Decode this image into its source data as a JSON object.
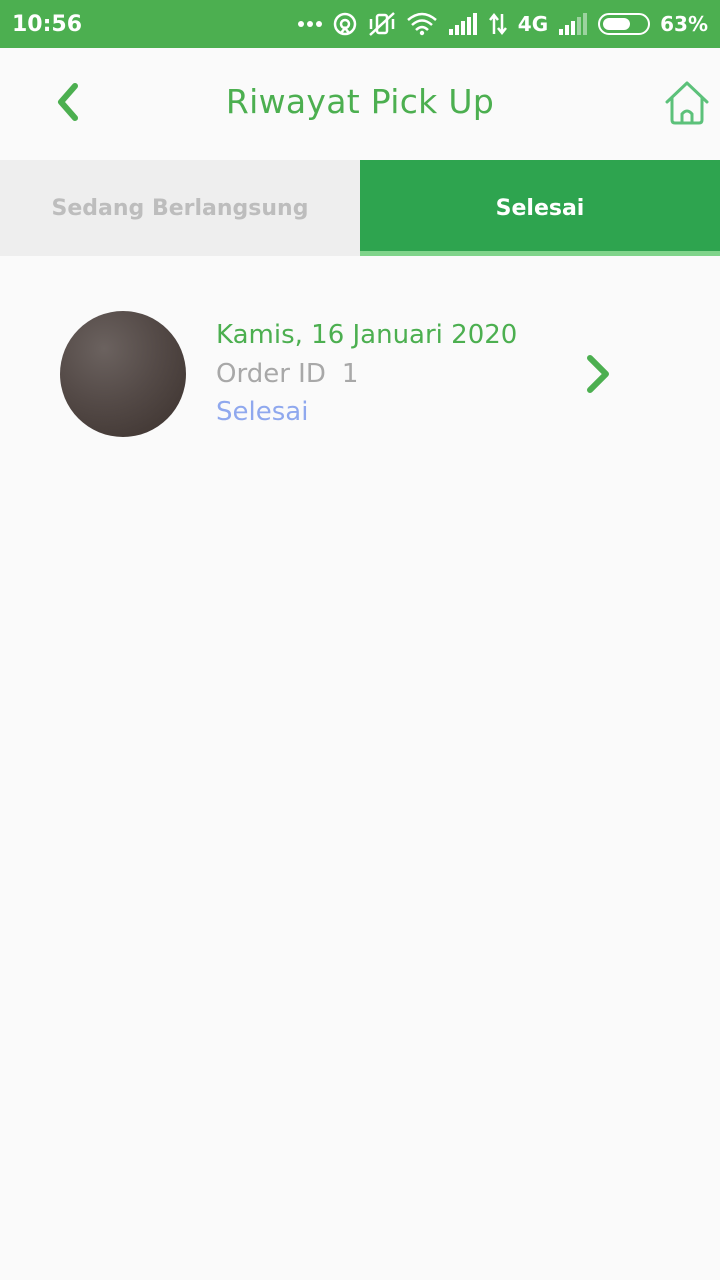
{
  "status_bar": {
    "time": "10:56",
    "network": "4G",
    "battery": "63%",
    "battery_level": 0.63,
    "icons": [
      "more-dots-icon",
      "sync-icon",
      "vibrate-off-icon",
      "wifi-icon",
      "signal-icon",
      "data-arrows-icon",
      "signal-icon-2",
      "battery-icon"
    ]
  },
  "app_bar": {
    "title": "Riwayat Pick Up",
    "back_icon": "chevron-left-icon",
    "home_icon": "home-icon"
  },
  "tabs": [
    {
      "label": "Sedang Berlangsung",
      "active": false
    },
    {
      "label": "Selesai",
      "active": true
    }
  ],
  "orders": [
    {
      "date": "Kamis, 16 Januari 2020",
      "order_id_label": "Order ID",
      "order_id": "1",
      "status": "Selesai",
      "chevron_icon": "chevron-right-icon"
    }
  ],
  "colors": {
    "primary": "#4caf50",
    "tab_active": "#2ea44f",
    "tab_inactive": "#eeeeee",
    "status_link": "#8fa8ee"
  }
}
